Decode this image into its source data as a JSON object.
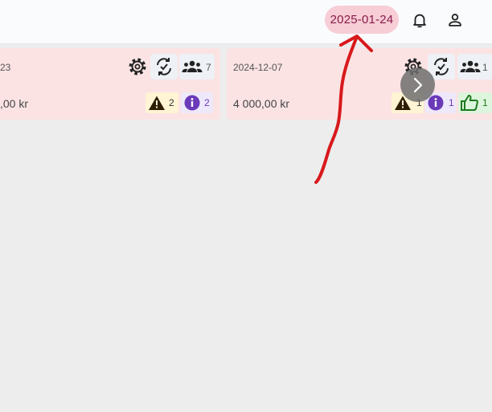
{
  "header": {
    "date": "2025-01-24",
    "notifications_icon": "bell-icon",
    "profile_icon": "person-icon"
  },
  "cards": [
    {
      "date": "23",
      "amount": ",00 kr",
      "participants": "7",
      "warnings": "2",
      "infos": "2"
    },
    {
      "date": "2024-12-07",
      "amount": "4 000,00 kr",
      "participants": "1",
      "warnings": "1",
      "infos": "1",
      "approvals": "1"
    }
  ],
  "colors": {
    "header_bg": "#fafbfd",
    "page_bg": "#ededed",
    "card_bg": "#fbe3e4",
    "date_pill_bg": "#f7cdd6",
    "date_pill_text": "#8a1b4a",
    "annotation_red": "#d8191c",
    "info_purple": "#6a3ab8",
    "ok_green": "#1e7a1e"
  }
}
